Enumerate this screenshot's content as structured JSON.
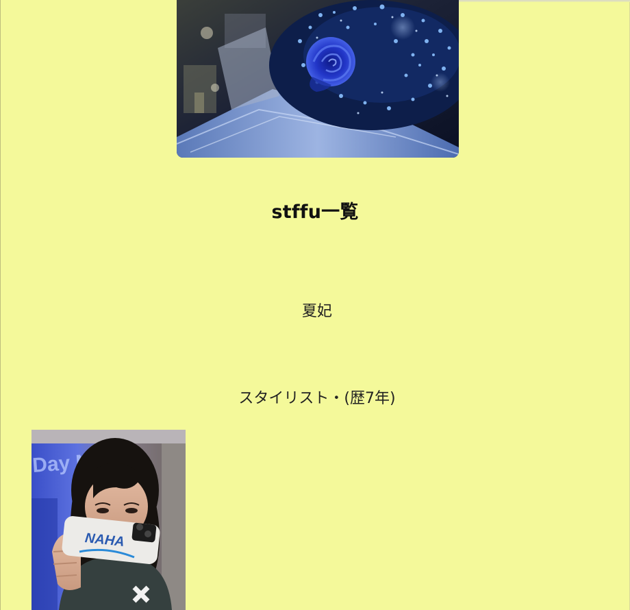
{
  "hero": {
    "image_alt": "blue rose bouquet",
    "palette": {
      "dark": "#0c1836",
      "blue": "#2a5fd8",
      "light": "#9fbdf0"
    }
  },
  "staff_list": {
    "title": "stffu一覧",
    "members": [
      {
        "name": "夏妃",
        "role": "スタイリスト・(歴7年)",
        "photo_alt": "staff photo holding phone with NAHA case",
        "phone_case_text": "NAHA",
        "sign_text": "Day Night"
      }
    ]
  },
  "colors": {
    "page_background": "#f4f99a",
    "text": "#222222"
  }
}
